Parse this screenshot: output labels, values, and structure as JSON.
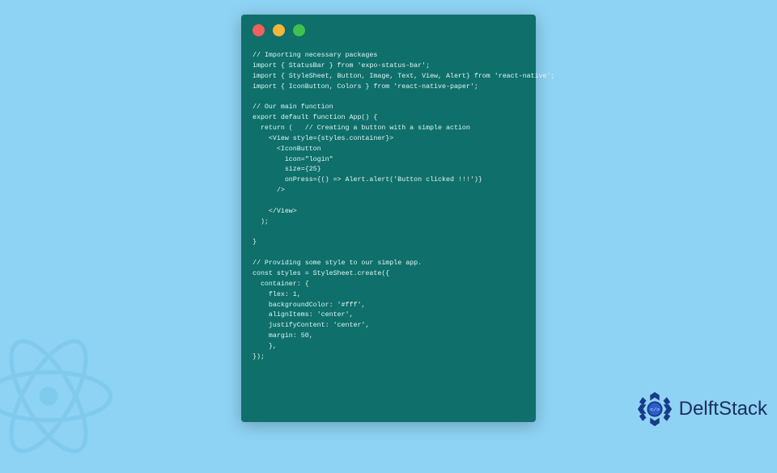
{
  "code_lines": [
    "// Importing necessary packages",
    "import { StatusBar } from 'expo-status-bar';",
    "import { StyleSheet, Button, Image, Text, View, Alert} from 'react-native';",
    "import { IconButton, Colors } from 'react-native-paper';",
    "",
    "// Our main function",
    "export default function App() {",
    "  return (   // Creating a button with a simple action",
    "    <View style={styles.container}>",
    "      <IconButton",
    "        icon=\"login\"",
    "        size={25}",
    "        onPress={() => Alert.alert('Button clicked !!!')}",
    "      />",
    "",
    "    </View>",
    "  );",
    "",
    "}",
    "",
    "// Providing some style to our simple app.",
    "const styles = StyleSheet.create({",
    "  container: {",
    "    flex: 1,",
    "    backgroundColor: '#fff',",
    "    alignItems: 'center',",
    "    justifyContent: 'center',",
    "    margin: 50,",
    "    },",
    "});"
  ],
  "brand": {
    "name": "DelftStack"
  },
  "colors": {
    "background": "#8fd3f4",
    "window": "#0f6f6a",
    "code_text": "#dff7f5",
    "brand_text": "#1a2e5c"
  }
}
